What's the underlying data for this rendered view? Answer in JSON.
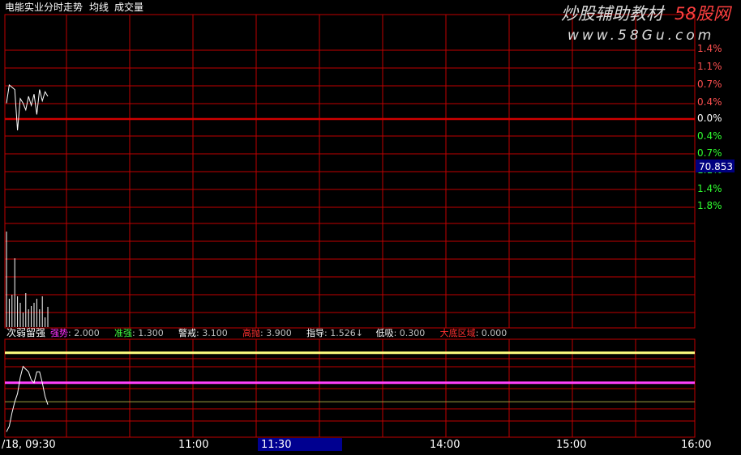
{
  "header": {
    "title": "电能实业分时走势",
    "avg_label": "均线",
    "vol_label": "成交量"
  },
  "watermark": {
    "line1_a": "炒股辅助教材",
    "line1_b": "58股网",
    "line2": "www.58Gu.com"
  },
  "price_axis": {
    "labels": [
      {
        "text": "1.4%",
        "color": "#ff5050"
      },
      {
        "text": "1.1%",
        "color": "#ff5050"
      },
      {
        "text": "0.7%",
        "color": "#ff5050"
      },
      {
        "text": "0.4%",
        "color": "#ff5050"
      },
      {
        "text": "0.0%",
        "color": "#ffffff"
      },
      {
        "text": "0.4%",
        "color": "#30ff30"
      },
      {
        "text": "0.7%",
        "color": "#30ff30"
      },
      {
        "text": "1.1%",
        "color": "#30ff30"
      },
      {
        "text": "1.4%",
        "color": "#30ff30"
      },
      {
        "text": "1.8%",
        "color": "#30ff30"
      }
    ],
    "current_price": "70.853"
  },
  "indicator": {
    "name": "次弱留强",
    "items": [
      {
        "label": "强势",
        "value": "2.000",
        "color": "#ff30ff"
      },
      {
        "label": "准强",
        "value": "1.300",
        "color": "#40ff40"
      },
      {
        "label": "警戒",
        "value": "3.100",
        "color": "#ffffff"
      },
      {
        "label": "高抛",
        "value": "3.900",
        "color": "#ff3030"
      },
      {
        "label": "指导",
        "value": "1.526↓",
        "color": "#ffffff"
      },
      {
        "label": "低吸",
        "value": "0.300",
        "color": "#ffffff"
      },
      {
        "label": "大底区域",
        "value": "0.000",
        "color": "#ff3030"
      }
    ]
  },
  "time_axis": {
    "labels": [
      "/18, 09:30",
      "11:00",
      "11:30",
      "14:00",
      "15:00",
      "16:00"
    ],
    "highlighted": "11:30"
  },
  "colors": {
    "grid": "#c00000",
    "zero_line": "#d00000",
    "price_line": "#ffffff",
    "yellow_line": "#ffff80",
    "magenta_line": "#ff40ff",
    "olive_line": "#a0a040",
    "price_box": "#000080",
    "time_highlight": "#000090"
  },
  "chart_data": {
    "type": "line",
    "price_series": [
      0.7,
      1.5,
      1.4,
      1.3,
      -0.5,
      0.9,
      0.7,
      0.4,
      1.0,
      0.6,
      1.1,
      0.2,
      1.3,
      0.8,
      1.2,
      1.0
    ],
    "volume_series": [
      118,
      35,
      40,
      85,
      38,
      30,
      18,
      42,
      22,
      26,
      30,
      35,
      22,
      38,
      12,
      25
    ],
    "indicator_series": [
      0.2,
      0.4,
      0.9,
      1.3,
      1.6,
      2.2,
      2.6,
      2.5,
      2.4,
      2.1,
      2.0,
      2.4,
      2.4,
      2.0,
      1.5,
      1.2
    ],
    "indicator_levels": {
      "yellow": 3.1,
      "magenta": 2.0,
      "olive": 1.3
    },
    "indicator_range": [
      0,
      3.6
    ]
  }
}
